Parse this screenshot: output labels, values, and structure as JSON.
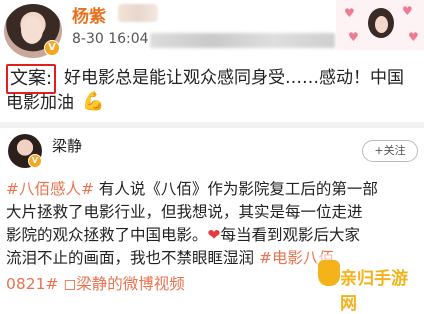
{
  "post1": {
    "author": "杨紫",
    "timestamp": "8-30 16:04",
    "copy_label": "文案:",
    "copy_line1": "好电影总是能让观众感同身受……感动！中国",
    "copy_line2": "电影加油",
    "muscle_icon": "💪"
  },
  "post2": {
    "author": "梁静",
    "follow_label": "+关注",
    "line1_tag": "#八佰感人#",
    "line1_rest": "有人说《八佰》作为影院复工后的第一部",
    "line2": "大片拯救了电影行业，但我想说，其实是每一位走进",
    "line3_a": "影院的观众拯救了中国电影。",
    "line3_heart": "❤",
    "line3_b": "每当看到观影后大家",
    "line4_a": "流泪不止的画面，我也不禁眼眶湿润",
    "line4_tag": "#电影八佰",
    "meta": "0821# ◻梁静的微博视频"
  },
  "watermark": {
    "text": "亲归手游网"
  }
}
